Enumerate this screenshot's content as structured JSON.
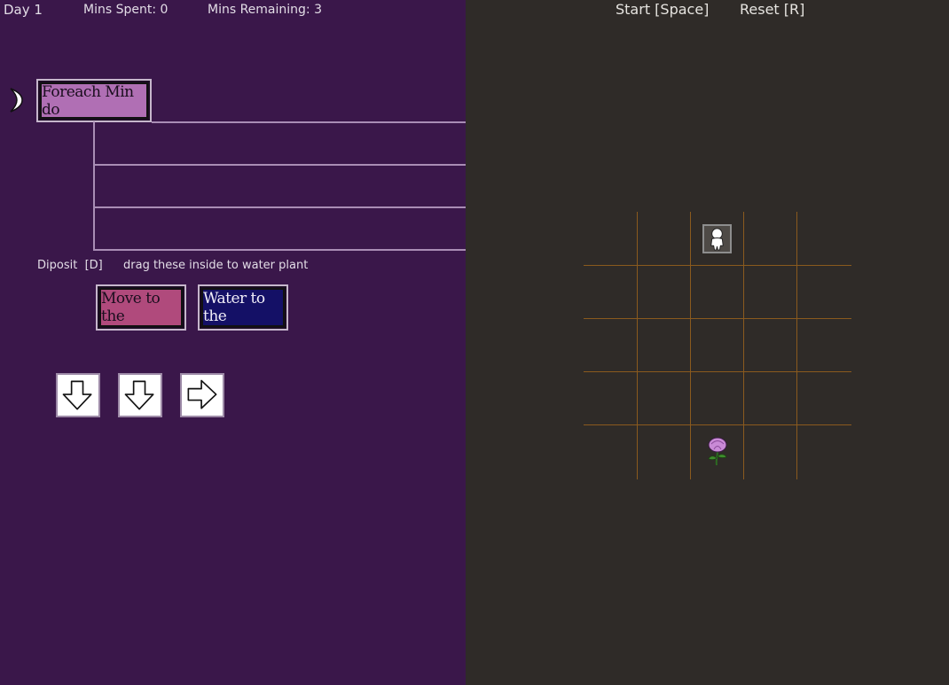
{
  "hud": {
    "day": "Day 1",
    "mins_spent": "Mins Spent: 0",
    "mins_remaining": "Mins Remaining: 3"
  },
  "controls": {
    "start": "Start [Space]",
    "reset": "Reset [R]"
  },
  "program": {
    "loop_block_label": "Foreach Min do",
    "slot_count": 3
  },
  "palette": {
    "deposit_label": "Diposit  [D]",
    "hint": "drag these inside to water plant",
    "move_block_label": "Move to the",
    "water_block_label": "Water to the",
    "arrow_tiles": [
      "down-arrow-icon",
      "down-arrow-icon",
      "right-arrow-icon"
    ]
  },
  "board": {
    "columns": 5,
    "rows": 5,
    "robot_cell": {
      "col": 2,
      "row": 0
    },
    "plant_cell": {
      "col": 2,
      "row": 4
    }
  },
  "colors": {
    "left_panel": "#3a174a",
    "right_panel": "#2f2b28",
    "grid_line": "#8a5a1e",
    "move_block": "#b04a7c",
    "water_block": "#141066",
    "loop_block": "#b06fb4"
  }
}
